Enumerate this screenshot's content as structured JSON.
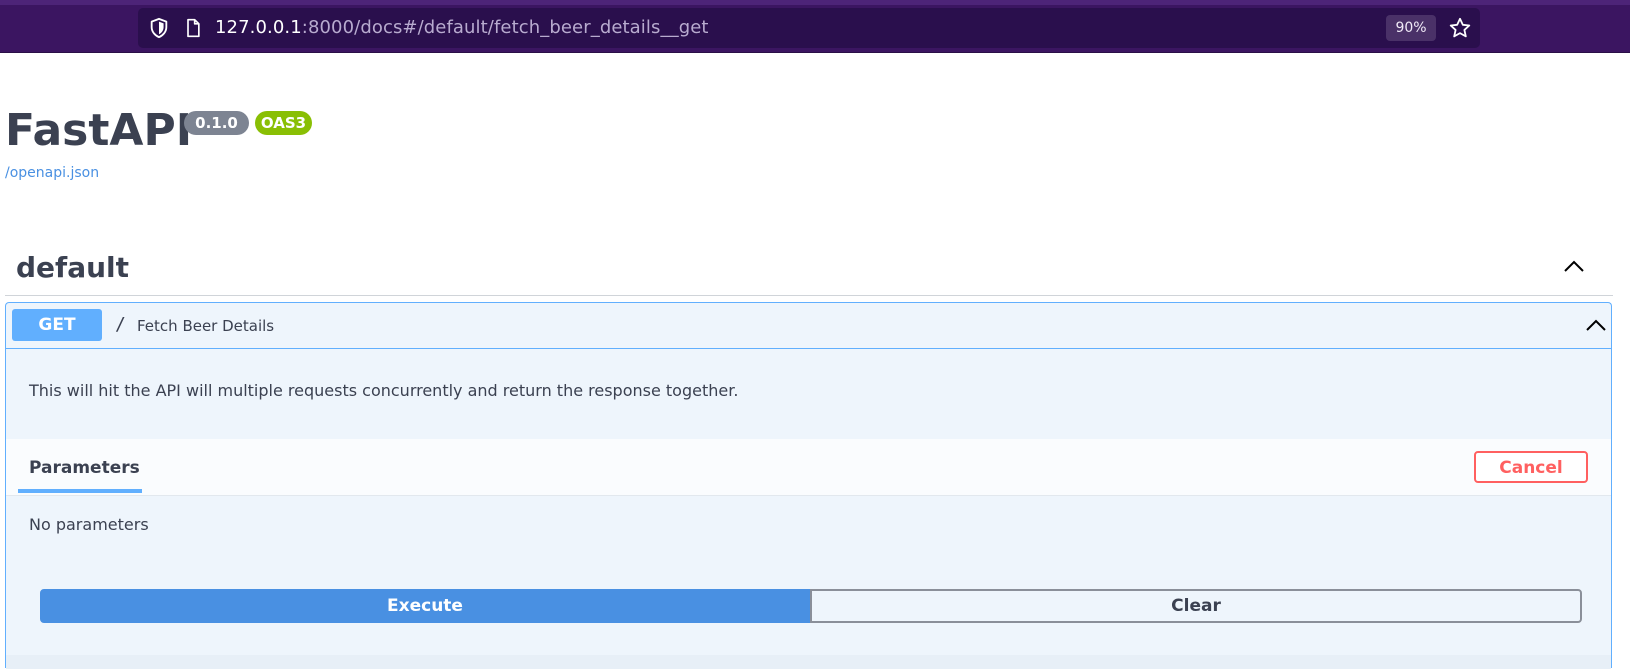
{
  "browser": {
    "url_host": "127.0.0.1",
    "url_path": ":8000/docs#/default/fetch_beer_details__get",
    "zoom": "90%",
    "icons": [
      "shield-icon",
      "page-icon",
      "star-icon"
    ]
  },
  "info": {
    "title": "FastAPI",
    "version": "0.1.0",
    "oas": "OAS3",
    "spec_link": "/openapi.json"
  },
  "tag": {
    "name": "default"
  },
  "operation": {
    "method": "GET",
    "path": "/",
    "summary": "Fetch Beer Details",
    "description": "This will hit the API will multiple requests concurrently and return the response together.",
    "parameters_tab": "Parameters",
    "cancel_label": "Cancel",
    "no_params": "No parameters",
    "execute_label": "Execute",
    "clear_label": "Clear"
  },
  "colors": {
    "get_accent": "#61affe",
    "execute_blue": "#4990e2",
    "cancel_red": "#ff6060",
    "version_badge": "#7d8492",
    "oas_badge": "#89bf04",
    "browser_bg": "#3b1561"
  }
}
